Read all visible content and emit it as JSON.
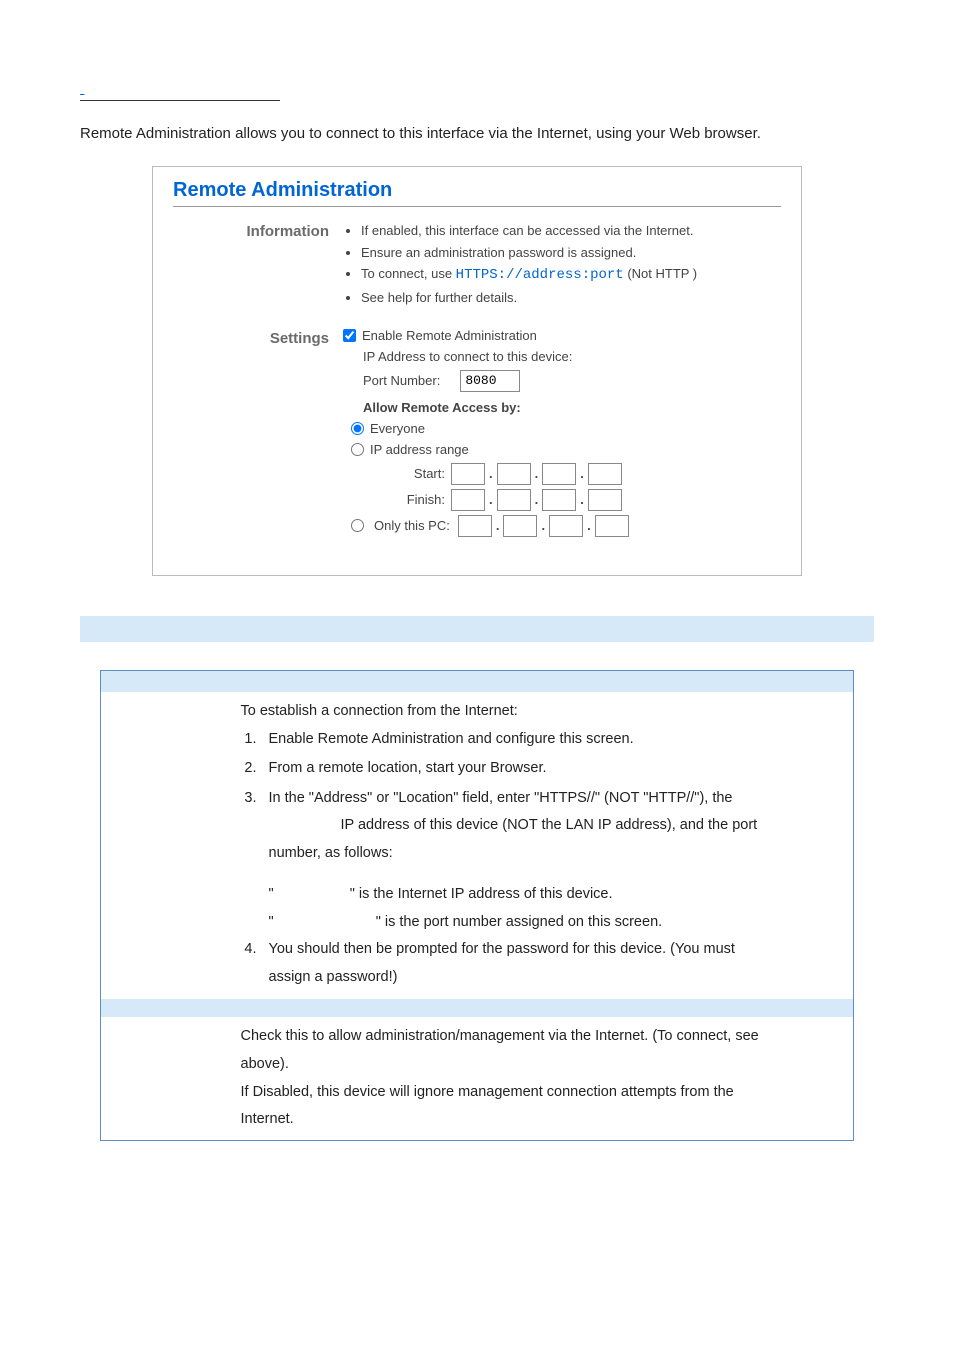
{
  "page": {
    "section_link": " ",
    "intro": "Remote Administration allows you to connect to this interface via the Internet, using your Web browser."
  },
  "panel": {
    "title": "Remote Administration",
    "info_label": "Information",
    "settings_label": "Settings",
    "info": {
      "bullet1": "If enabled, this interface can be accessed via the Internet.",
      "bullet2": "Ensure an administration password is assigned.",
      "bullet3_prefix": "To connect, use ",
      "bullet3_https": "HTTPS://address:port",
      "bullet3_suffix": "  (Not HTTP )",
      "bullet4": "See help for further details."
    },
    "settings": {
      "enable_label": "Enable Remote Administration",
      "enable_checked": true,
      "ip_connect_label": "IP Address to connect to this device:",
      "port_label": "Port Number:",
      "port_value": "8080",
      "allow_label": "Allow Remote Access by:",
      "opt_everyone": "Everyone",
      "opt_iprange": "IP address range",
      "opt_onlypc": "Only this PC:",
      "start_label": "Start:",
      "finish_label": "Finish:"
    }
  },
  "table": {
    "info_header": "",
    "info_left": "",
    "settings_header": "",
    "enable_left": "",
    "connection": {
      "intro": "To establish a connection from the Internet:",
      "step1": "Enable Remote Administration and configure this screen.",
      "step2": "From a remote location, start your Browser.",
      "step3a": "In the \"Address\" or \"Location\" field, enter \"HTTPS//\" (NOT \"HTTP//\"), the",
      "step3b": "IP address of this device (NOT the LAN IP address), and the port",
      "step3c": "number, as follows:",
      "example_q1": "\"",
      "example_a1": "\" is the Internet IP address of this device.",
      "example_q2": "\"",
      "example_a2": "\" is the port number assigned on this screen.",
      "step4a": "You should then be prompted for the password for this device. (You must",
      "step4b": "assign a password!)"
    },
    "enable": {
      "line1": "Check this to allow administration/management via the Internet. (To connect, see",
      "line2": "above).",
      "line3": "If Disabled, this device will ignore management connection attempts from the",
      "line4": "Internet."
    }
  }
}
